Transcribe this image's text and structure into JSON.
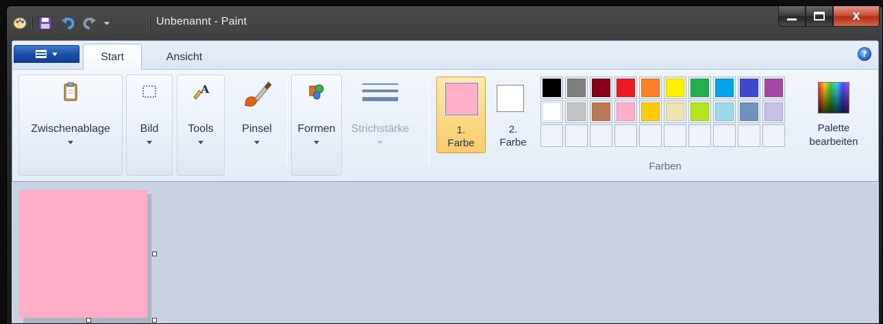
{
  "window": {
    "title": "Unbenannt - Paint"
  },
  "quick_access": {
    "items": [
      "save-icon",
      "undo-icon",
      "redo-icon",
      "customize-arrow-icon"
    ]
  },
  "tabs": {
    "start": "Start",
    "ansicht": "Ansicht"
  },
  "ribbon": {
    "groups": {
      "clipboard": "Zwischenablage",
      "image": "Bild",
      "tools": "Tools",
      "brushes": "Pinsel",
      "shapes": "Formen",
      "stroke": "Strichstärke"
    },
    "colors": {
      "color1_label_line1": "1.",
      "color1_label_line2": "Farbe",
      "color2_label_line1": "2.",
      "color2_label_line2": "Farbe",
      "color1": "#ffaec9",
      "color2": "#ffffff",
      "group_label": "Farben",
      "edit_line1": "Palette",
      "edit_line2": "bearbeiten",
      "palette_row1": [
        "#000000",
        "#7f7f7f",
        "#880015",
        "#ed1c24",
        "#ff7f27",
        "#fff200",
        "#22b14c",
        "#00a2e8",
        "#3f48cc",
        "#a349a4"
      ],
      "palette_row2": [
        "#ffffff",
        "#c3c3c3",
        "#b97a57",
        "#ffaec9",
        "#ffc90e",
        "#efe4b0",
        "#b5e61d",
        "#99d9ea",
        "#7092be",
        "#c8bfe7"
      ]
    }
  },
  "canvas": {
    "fill": "#ffaec9"
  }
}
